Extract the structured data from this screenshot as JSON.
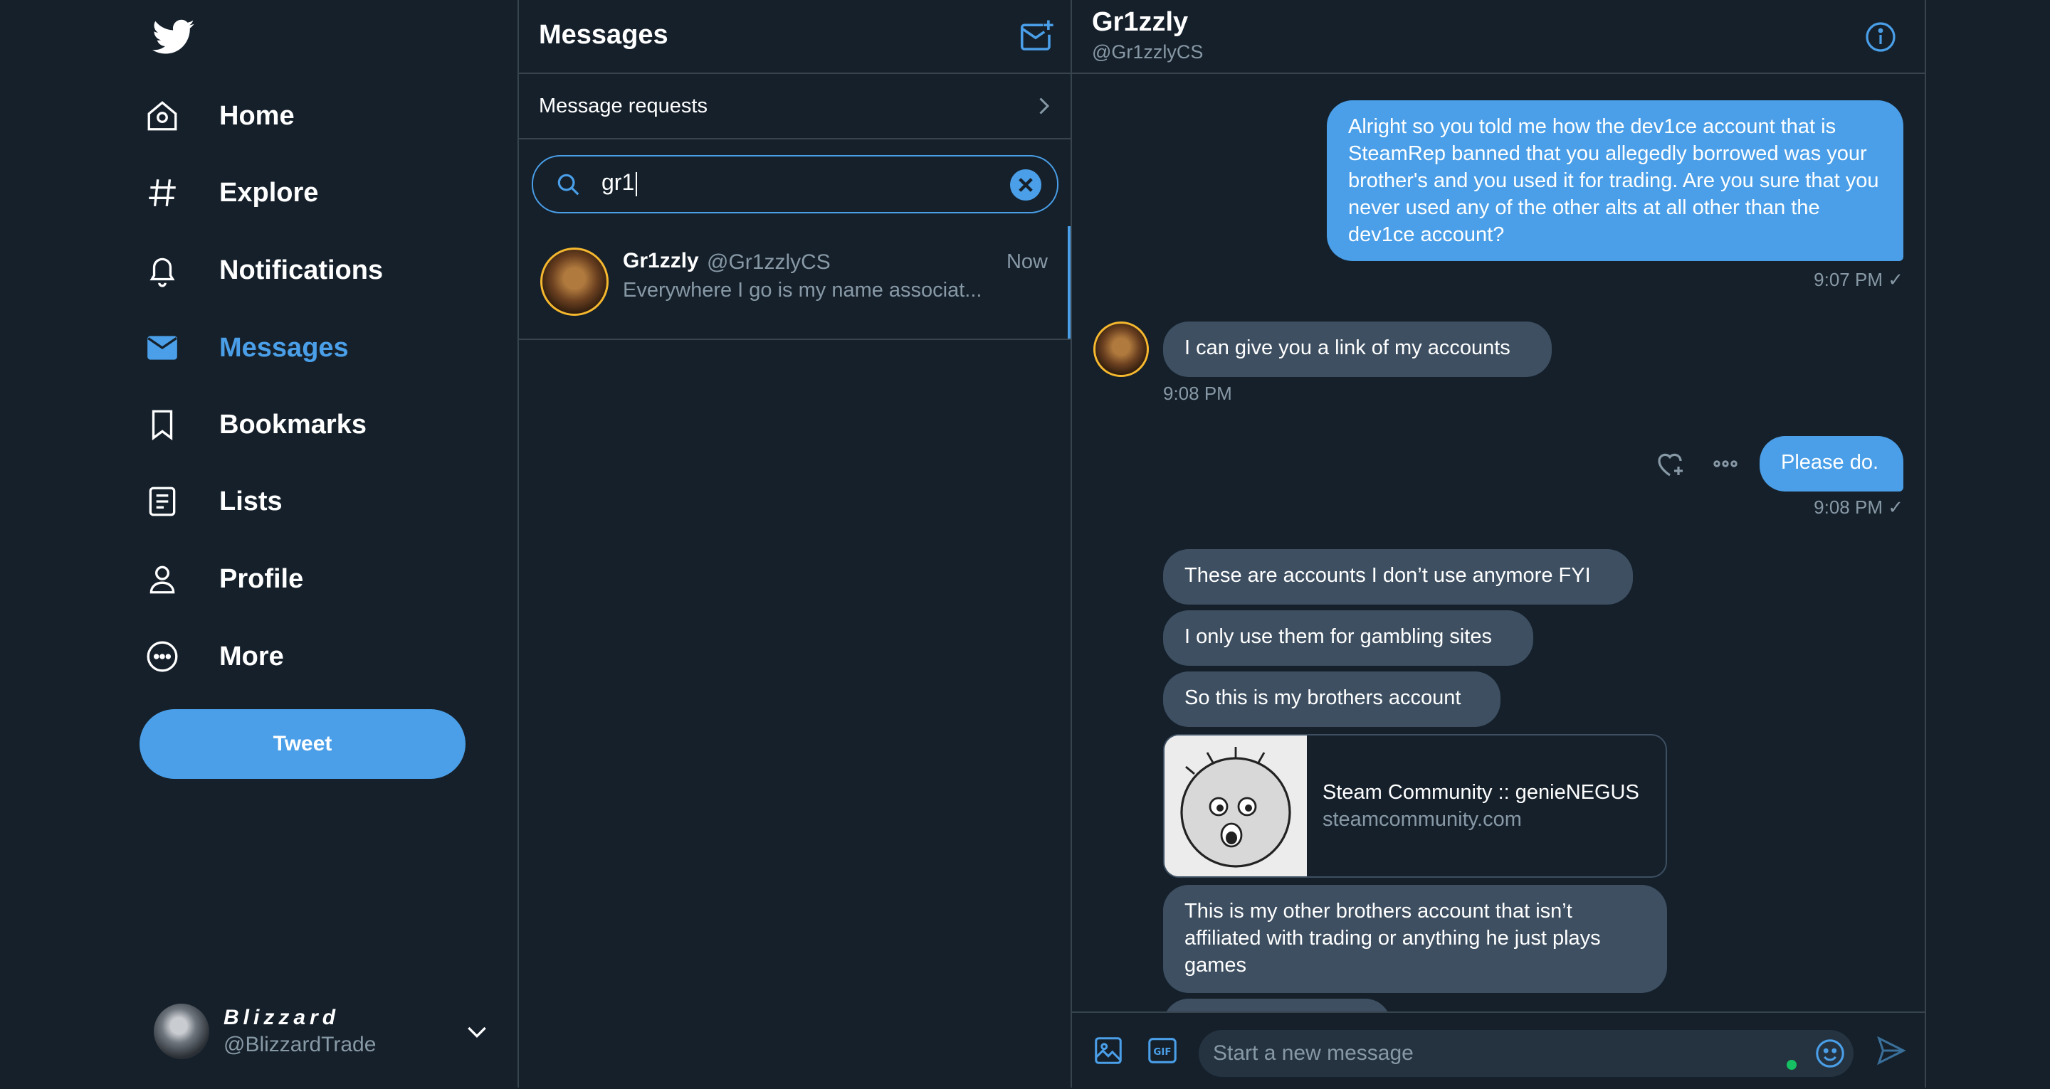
{
  "nav": {
    "items": [
      {
        "label": "Home",
        "icon": "home-icon"
      },
      {
        "label": "Explore",
        "icon": "hashtag-icon"
      },
      {
        "label": "Notifications",
        "icon": "bell-icon"
      },
      {
        "label": "Messages",
        "icon": "envelope-icon",
        "active": true
      },
      {
        "label": "Bookmarks",
        "icon": "bookmark-icon"
      },
      {
        "label": "Lists",
        "icon": "list-icon"
      },
      {
        "label": "Profile",
        "icon": "person-icon"
      },
      {
        "label": "More",
        "icon": "more-circle-icon"
      }
    ],
    "tweet_button": "Tweet",
    "account": {
      "name": "Blizzard",
      "handle": "@BlizzardTrade"
    }
  },
  "messages": {
    "title": "Messages",
    "requests_label": "Message requests",
    "search": {
      "value": "gr1"
    },
    "conversation": {
      "name": "Gr1zzly",
      "handle": "@Gr1zzlyCS",
      "time": "Now",
      "preview": "Everywhere I go is my name associat..."
    }
  },
  "chat": {
    "name": "Gr1zzly",
    "handle": "@Gr1zzlyCS",
    "messages": [
      {
        "dir": "out",
        "text": "Alright so you told me how the dev1ce account that is SteamRep banned that you allegedly borrowed was your brother's and you used it for trading. Are you sure that you never used any of the other alts at all other than the dev1ce account?",
        "meta": "9:07 PM ✓"
      },
      {
        "dir": "in",
        "text": "I can give you a link of my accounts",
        "meta": "9:08 PM"
      },
      {
        "dir": "out",
        "text": "Please do.",
        "meta": "9:08 PM ✓"
      },
      {
        "dir": "in",
        "text": "These are accounts I don’t use anymore FYI"
      },
      {
        "dir": "in",
        "text": "I only use them for gambling sites"
      },
      {
        "dir": "in",
        "text": "So this is my brothers account"
      },
      {
        "dir": "in",
        "text": "This is my other brothers account that isn’t affiliated with trading or anything he just plays games"
      }
    ],
    "link_card": {
      "title": "Steam Community :: genieNEGUS",
      "domain": "steamcommunity.com"
    },
    "composer": {
      "placeholder": "Start a new message"
    }
  },
  "colors": {
    "background": "#15202b",
    "accent": "#4a9fe8",
    "bubble_in": "#3d4f61",
    "muted": "#8899a6"
  }
}
